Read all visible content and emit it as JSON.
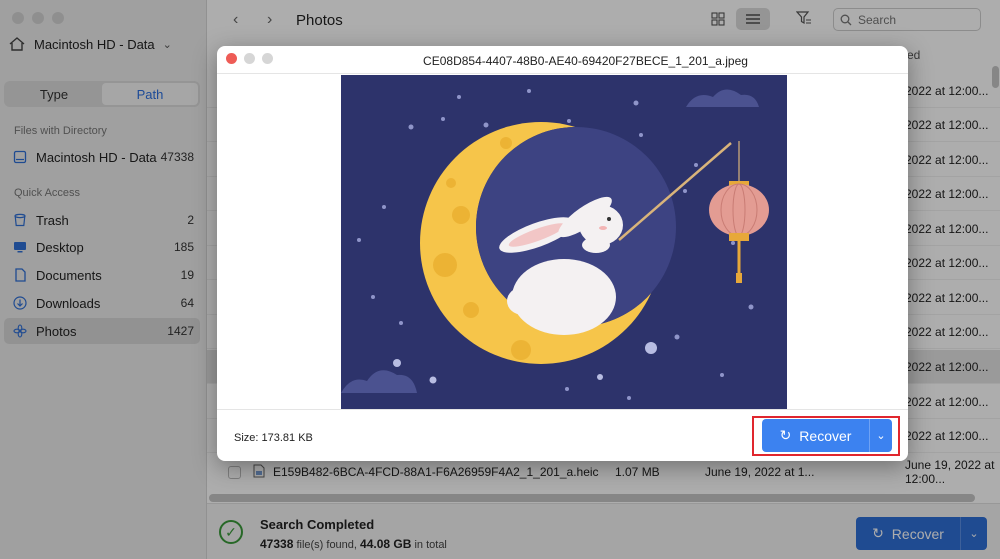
{
  "sidebar": {
    "drive": "Macintosh HD - Data",
    "tabs": [
      {
        "label": "Type"
      },
      {
        "label": "Path"
      }
    ],
    "files_section": "Files with Directory",
    "files_item": {
      "label": "Macintosh HD - Data",
      "count": "47338"
    },
    "quick_section": "Quick Access",
    "items": [
      {
        "label": "Trash",
        "count": "2",
        "icon": "trash-icon"
      },
      {
        "label": "Desktop",
        "count": "185",
        "icon": "desktop-icon"
      },
      {
        "label": "Documents",
        "count": "19",
        "icon": "document-icon"
      },
      {
        "label": "Downloads",
        "count": "64",
        "icon": "download-icon"
      },
      {
        "label": "Photos",
        "count": "1427",
        "icon": "photos-icon"
      }
    ]
  },
  "main": {
    "title": "Photos",
    "search_placeholder": "Search",
    "column_fragment": "ed",
    "dates": [
      "2022 at 12:00...",
      "2022 at 12:00...",
      "2022 at 12:00...",
      "2022 at 12:00...",
      "2022 at 12:00...",
      "2022 at 12:00...",
      "2022 at 12:00...",
      "2022 at 12:00...",
      "2022 at 12:00...",
      "2022 at 12:00...",
      "2022 at 12:00...",
      "2022 at 12:00..."
    ],
    "last_row": {
      "name": "E159B482-6BCA-4FCD-88A1-F6A26959F4A2_1_201_a.heic",
      "size": "1.07 MB",
      "date1": "June 19, 2022 at 1...",
      "date2": "June 19, 2022 at 12:00..."
    }
  },
  "footer": {
    "status": "Search Completed",
    "files_found": "47338",
    "files_text": "file(s) found,",
    "total_size": "44.08 GB",
    "total_text": "in total",
    "recover_label": "Recover"
  },
  "modal": {
    "filename": "CE08D854-4407-48B0-AE40-69420F27BECE_1_201_a.jpeg",
    "size_label": "Size: 173.81 KB",
    "recover_label": "Recover"
  },
  "colors": {
    "accent": "#3c82f0",
    "footer_button": "#2f6fd6",
    "highlight_box": "#e0262e",
    "preview_bg": "#2d336b",
    "moon": "#f6c54a"
  }
}
